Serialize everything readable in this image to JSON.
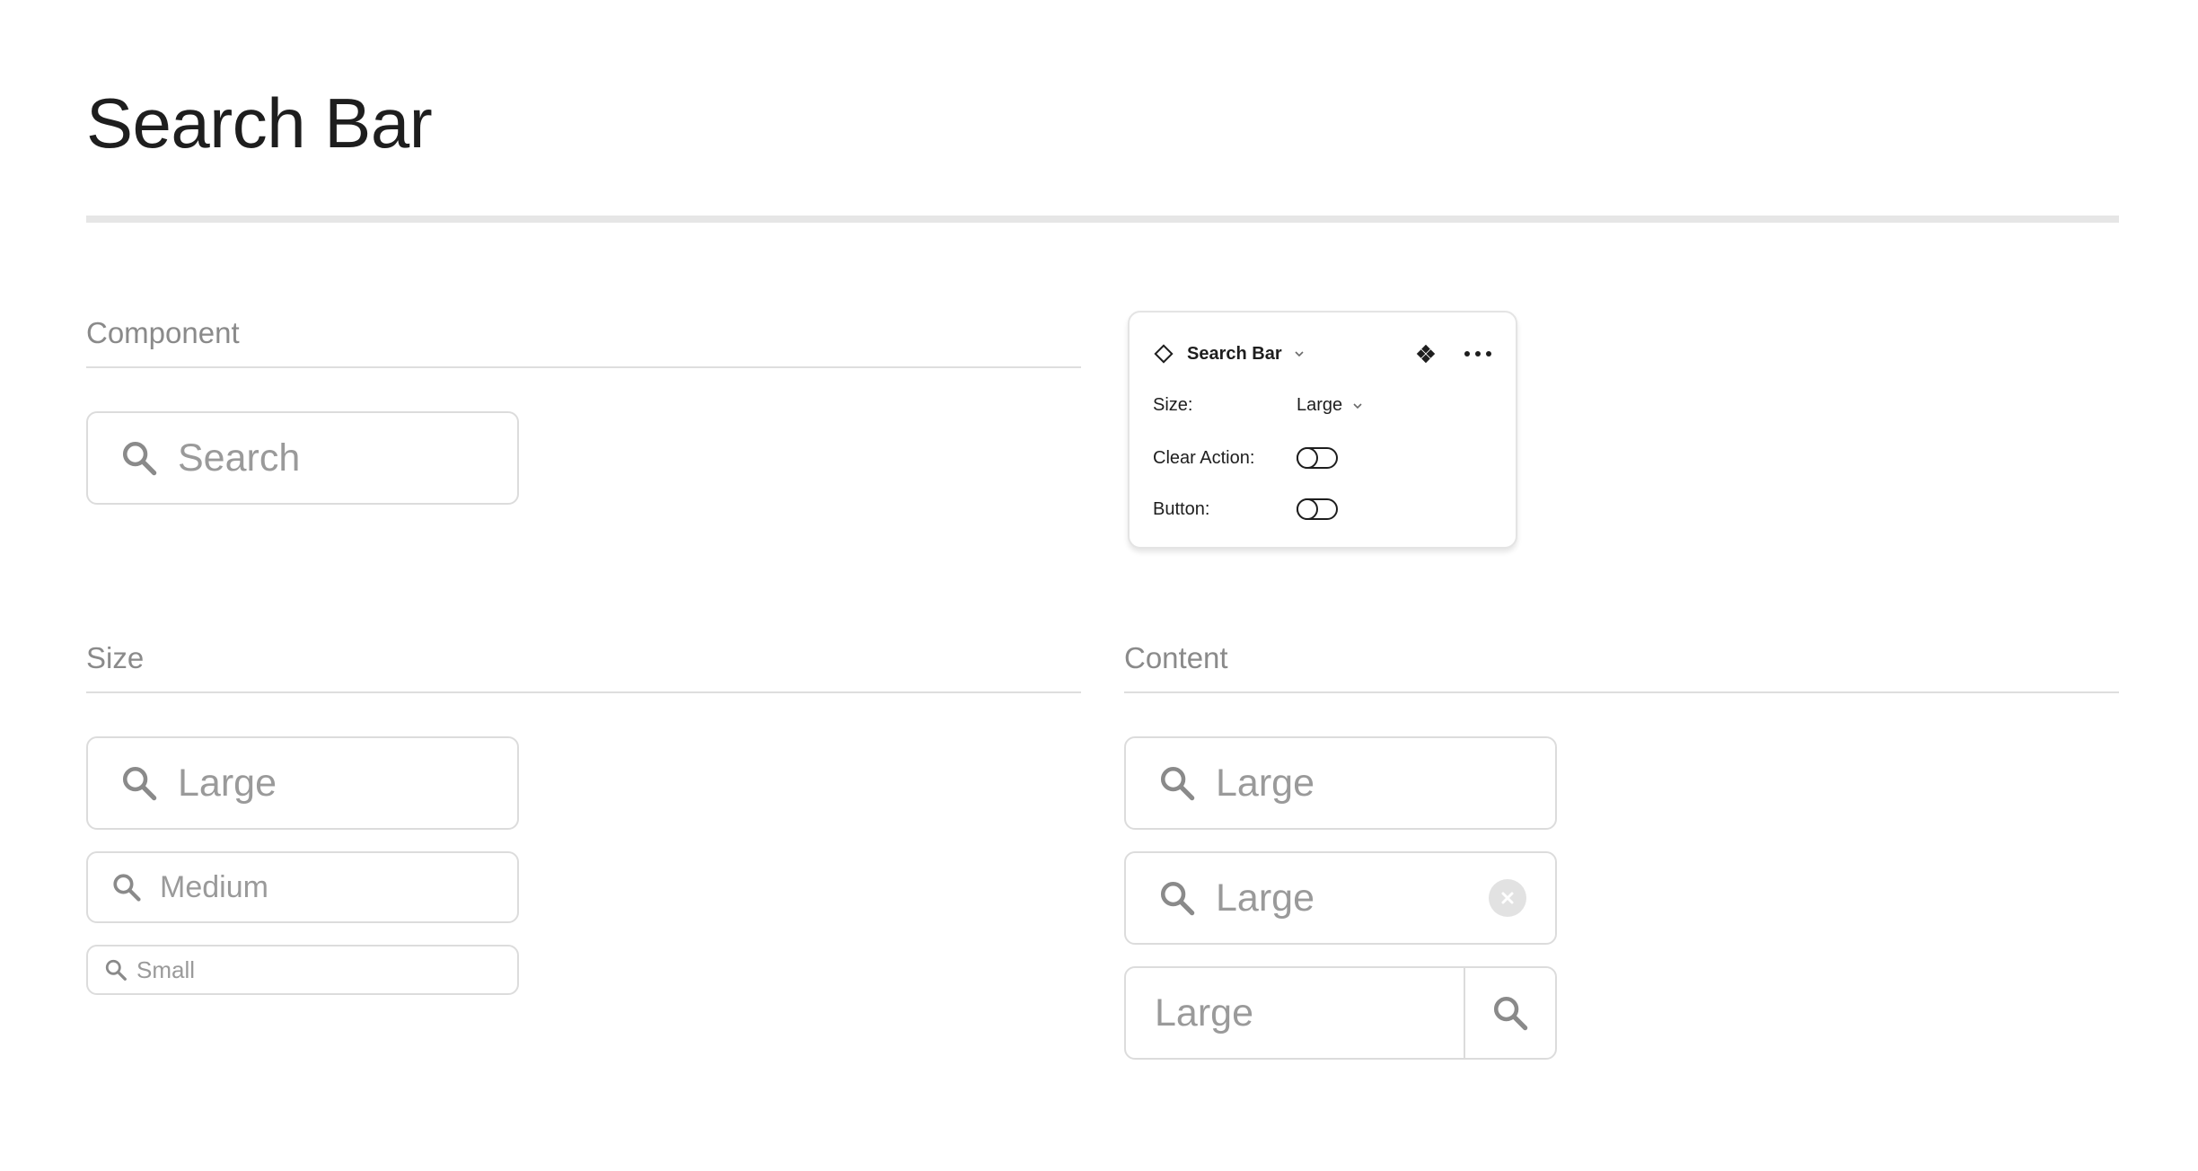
{
  "page": {
    "title": "Search Bar"
  },
  "sections": {
    "component": {
      "title": "Component",
      "search_placeholder": "Search"
    },
    "size": {
      "title": "Size",
      "large_placeholder": "Large",
      "medium_placeholder": "Medium",
      "small_placeholder": "Small"
    },
    "content": {
      "title": "Content",
      "default_placeholder": "Large",
      "clear_action_placeholder": "Large",
      "button_placeholder": "Large"
    }
  },
  "panel": {
    "component_name": "Search Bar",
    "props": {
      "size": {
        "label": "Size:",
        "value": "Large"
      },
      "clear_action": {
        "label": "Clear Action:",
        "enabled": false
      },
      "button": {
        "label": "Button:",
        "enabled": false
      }
    }
  },
  "icons": {
    "search": "search-icon",
    "clear": "clear-icon",
    "component": "component-diamond-icon",
    "instance": "instance-icon",
    "more": "more-icon",
    "chevron": "chevron-down-icon"
  },
  "colors": {
    "title": "#1e1e1e",
    "section_title": "#8a8a8a",
    "placeholder": "#9a9a9a",
    "border": "#dcdcdc",
    "icon": "#8a8a8a"
  }
}
